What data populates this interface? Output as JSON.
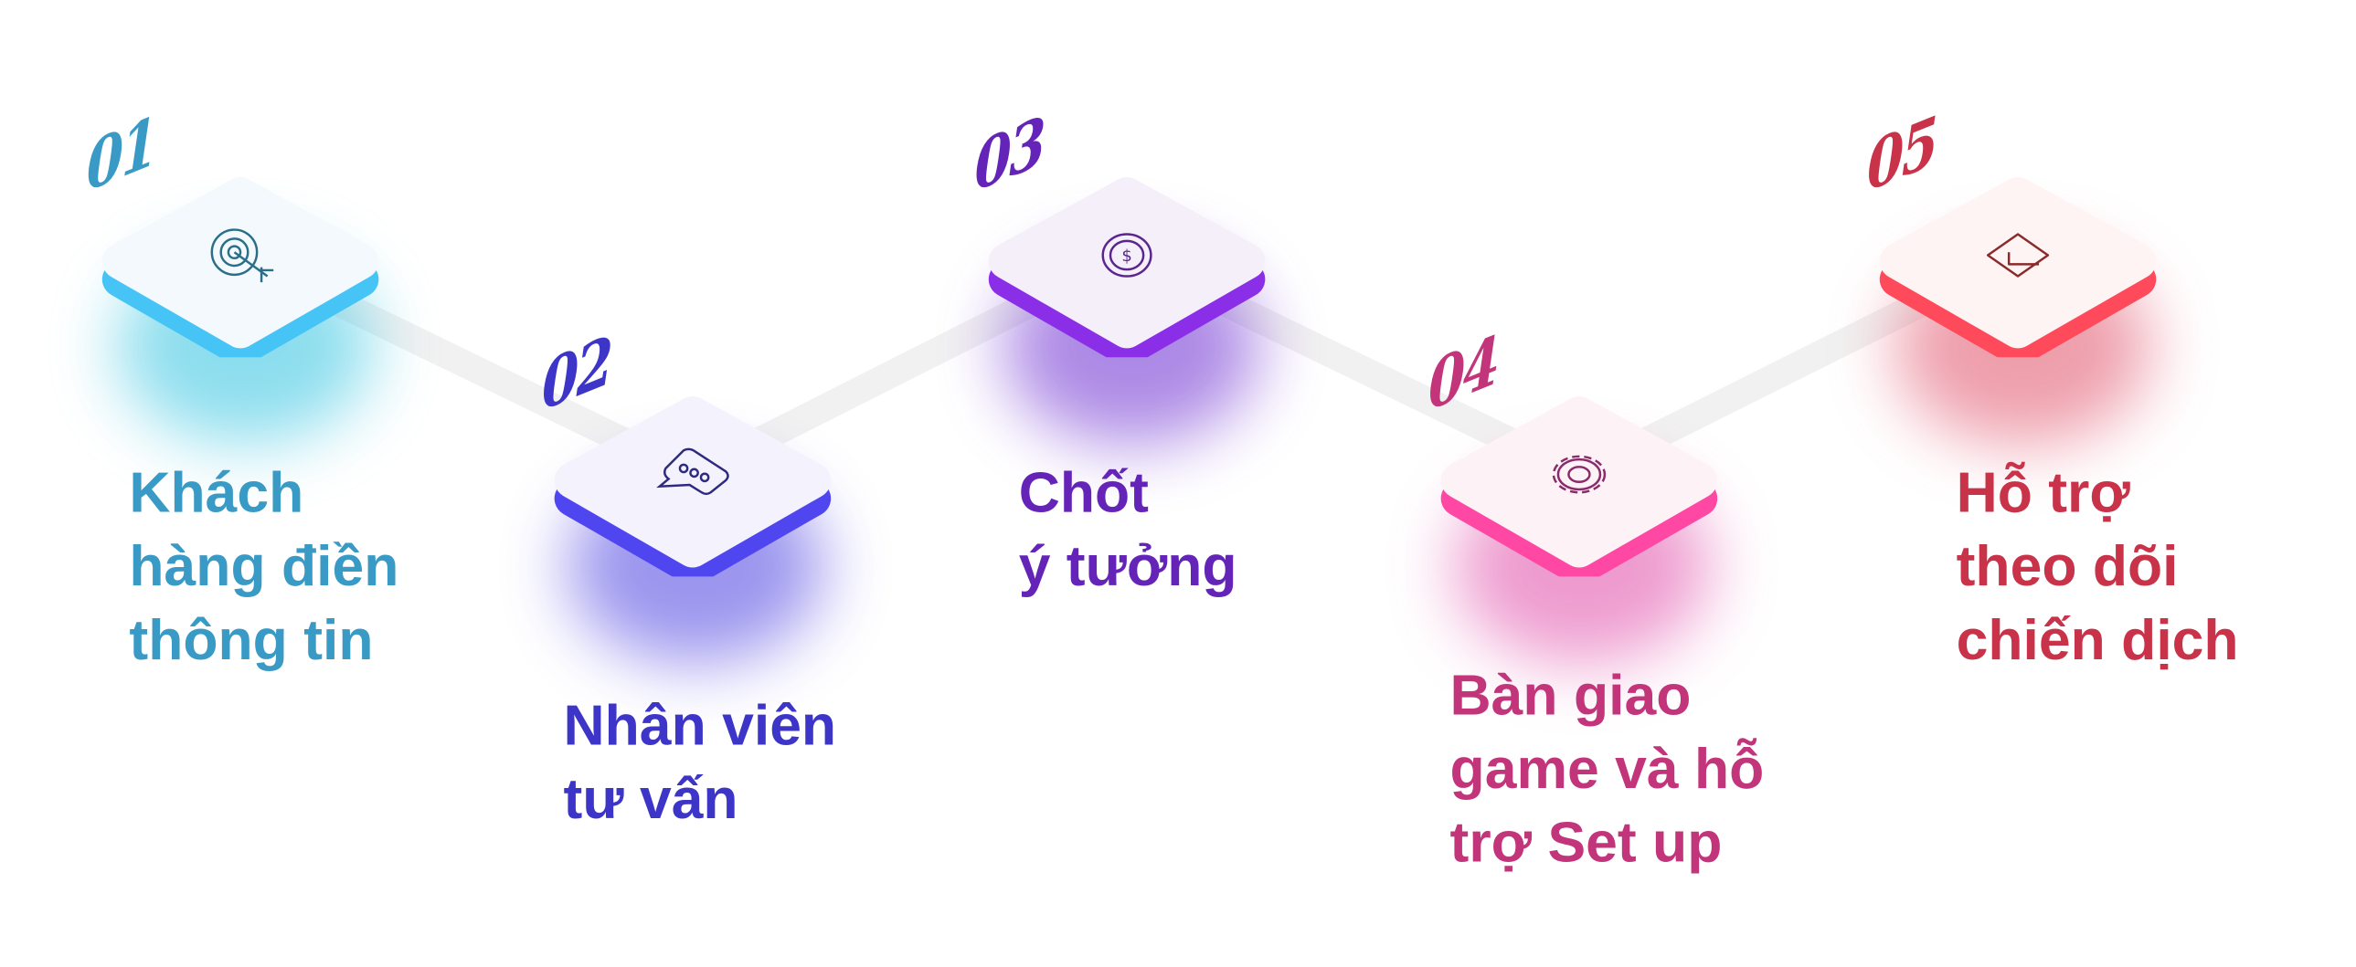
{
  "steps": [
    {
      "number": "01",
      "label_lines": [
        "Khách",
        "hàng điền",
        "thông tin"
      ],
      "icon": "target-arrow-icon",
      "color": "#3a9ac6",
      "accent": "#45c4f5",
      "face": "#f4f9fd",
      "glow": "#2ec2e0"
    },
    {
      "number": "02",
      "label_lines": [
        "Nhân viên",
        "tư vấn"
      ],
      "icon": "chat-bubble-icon",
      "color": "#3d35c8",
      "accent": "#4f46f0",
      "face": "#f4f3fd",
      "glow": "#4a3fe0"
    },
    {
      "number": "03",
      "label_lines": [
        "Chốt",
        "ý tưởng"
      ],
      "icon": "dollar-coin-icon",
      "color": "#6524b8",
      "accent": "#8a2ee8",
      "face": "#f4eff9",
      "glow": "#6a2ad0"
    },
    {
      "number": "04",
      "label_lines": [
        "Bàn giao",
        "game và hỗ",
        "trợ Set up"
      ],
      "icon": "gear-icon",
      "color": "#c2357a",
      "accent": "#ff47a4",
      "face": "#fdf3f7",
      "glow": "#e04aa8"
    },
    {
      "number": "05",
      "label_lines": [
        "Hỗ trợ",
        "theo dõi",
        "chiến dịch"
      ],
      "icon": "diamond-check-icon",
      "color": "#c8334a",
      "accent": "#ff4a5c",
      "face": "#fdf4f3",
      "glow": "#e05068"
    }
  ],
  "connector_color": "#f1f1f1"
}
